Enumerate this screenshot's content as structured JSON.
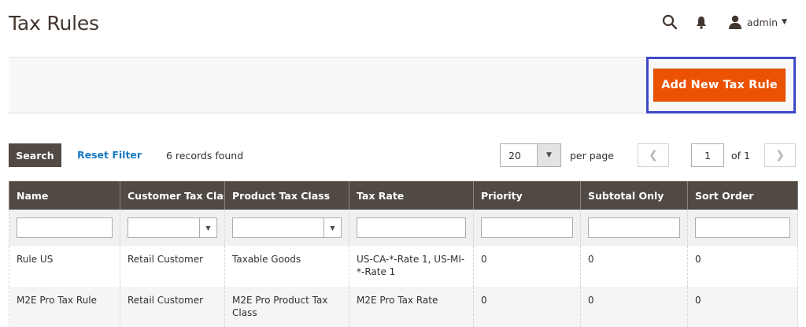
{
  "page": {
    "title": "Tax Rules"
  },
  "header": {
    "user_name": "admin",
    "search_icon": "search-icon",
    "bell_icon": "bell-icon",
    "user_icon": "user-icon"
  },
  "actions": {
    "add_new_label": "Add New Tax Rule",
    "accent_color": "#eb5202",
    "highlight_color": "#3f48c8"
  },
  "grid_controls": {
    "search_label": "Search",
    "reset_label": "Reset Filter",
    "records_found": "6 records found",
    "per_page_value": "20",
    "per_page_label": "per page",
    "current_page": "1",
    "of_pages": "of 1"
  },
  "columns": [
    "Name",
    "Customer Tax Class",
    "Product Tax Class",
    "Tax Rate",
    "Priority",
    "Subtotal Only",
    "Sort Order"
  ],
  "rows": [
    [
      "Rule US",
      "Retail Customer",
      "Taxable Goods",
      "US-CA-*-Rate 1, US-MI-*-Rate 1",
      "0",
      "0",
      "0"
    ],
    [
      "M2E Pro Tax Rule",
      "Retail Customer",
      "M2E Pro Product Tax Class",
      "M2E Pro Tax Rate",
      "0",
      "0",
      "0"
    ]
  ]
}
